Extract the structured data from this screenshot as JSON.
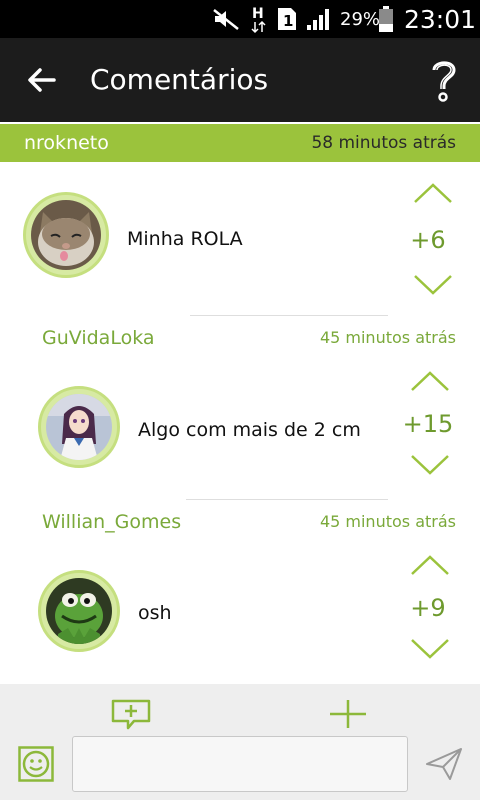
{
  "status_bar": {
    "battery_percent": "29%",
    "time": "23:01",
    "sim_label": "1",
    "network_label": "H"
  },
  "app_bar": {
    "title": "Comentários"
  },
  "comments": [
    {
      "user": "nrokneto",
      "time": "58 minutos atrás",
      "text": "Minha ROLA",
      "score": "+6"
    },
    {
      "user": "GuVidaLoka",
      "time": "45 minutos atrás",
      "text": "Algo com mais de 2 cm",
      "score": "+15"
    },
    {
      "user": "Willian_Gomes",
      "time": "45 minutos atrás",
      "text": "osh",
      "score": "+9"
    }
  ],
  "bottom_bar": {
    "input_value": ""
  },
  "colors": {
    "accent": "#9bc33c",
    "score": "#6e9a2e",
    "app_bar": "#1c1c1c"
  }
}
